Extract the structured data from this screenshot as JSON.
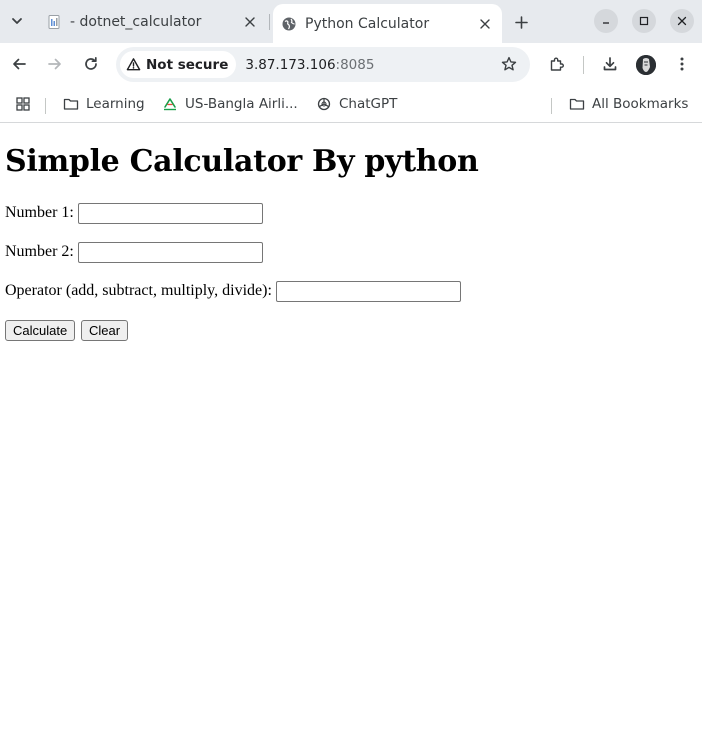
{
  "browser": {
    "tabs": [
      {
        "title": "- dotnet_calculator",
        "active": false
      },
      {
        "title": "Python Calculator",
        "active": true
      }
    ],
    "address_bar": {
      "security_label": "Not secure",
      "host": "3.87.173.106",
      "port": ":8085"
    },
    "bookmarks": [
      {
        "label": "Learning",
        "icon": "folder-icon"
      },
      {
        "label": "US-Bangla Airli...",
        "icon": "usbangla-favicon"
      },
      {
        "label": "ChatGPT",
        "icon": "chatgpt-icon"
      }
    ],
    "all_bookmarks_label": "All Bookmarks"
  },
  "page": {
    "heading": "Simple Calculator By python",
    "fields": {
      "number1": {
        "label": "Number 1:",
        "value": ""
      },
      "number2": {
        "label": "Number 2:",
        "value": ""
      },
      "operator": {
        "label": "Operator (add, subtract, multiply, divide):",
        "value": ""
      }
    },
    "buttons": {
      "calculate": "Calculate",
      "clear": "Clear"
    }
  },
  "colors": {
    "tabstrip_bg": "#e7eaee",
    "omnibox_bg": "#eef1f4",
    "button_bg": "#efefef",
    "usbangla_accent": "#1a9e4a"
  }
}
